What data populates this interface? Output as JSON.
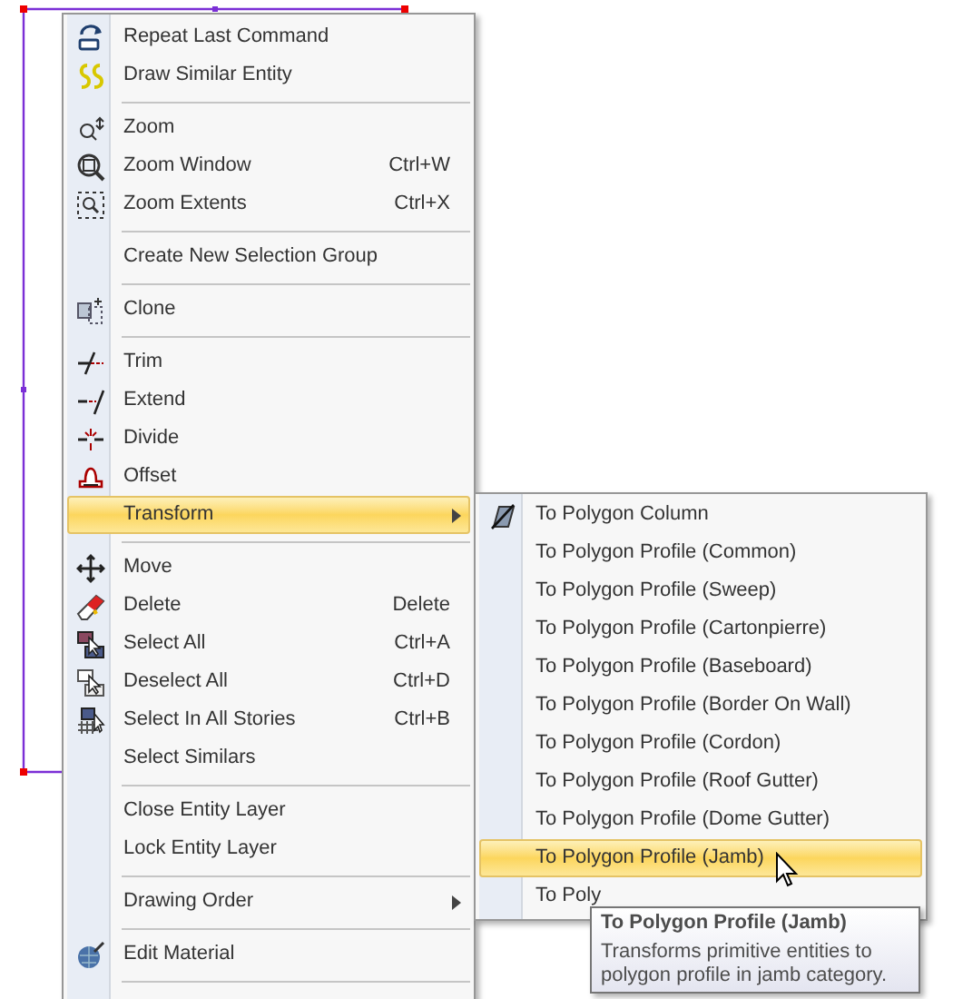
{
  "menu": {
    "items": [
      {
        "kind": "item",
        "label": "Repeat Last Command",
        "selected": false
      },
      {
        "kind": "item",
        "label": "Draw Similar Entity",
        "selected": false
      },
      {
        "kind": "separator"
      },
      {
        "kind": "item",
        "label": "Zoom",
        "selected": false
      },
      {
        "kind": "item",
        "label": "Zoom Window",
        "shortcut": "Ctrl+W",
        "selected": false
      },
      {
        "kind": "item",
        "label": "Zoom Extents",
        "shortcut": "Ctrl+X",
        "selected": false
      },
      {
        "kind": "separator"
      },
      {
        "kind": "item",
        "label": "Create New Selection Group",
        "selected": false
      },
      {
        "kind": "separator"
      },
      {
        "kind": "item",
        "label": "Clone",
        "selected": false
      },
      {
        "kind": "separator"
      },
      {
        "kind": "item",
        "label": "Trim",
        "selected": false
      },
      {
        "kind": "item",
        "label": "Extend",
        "selected": false
      },
      {
        "kind": "item",
        "label": "Divide",
        "selected": false
      },
      {
        "kind": "item",
        "label": "Offset",
        "selected": false
      },
      {
        "kind": "submenu",
        "label": "Transform",
        "selected": true
      },
      {
        "kind": "separator"
      },
      {
        "kind": "item",
        "label": "Move",
        "selected": false
      },
      {
        "kind": "item",
        "label": "Delete",
        "shortcut": "Delete",
        "selected": false
      },
      {
        "kind": "item",
        "label": "Select All",
        "shortcut": "Ctrl+A",
        "selected": false
      },
      {
        "kind": "item",
        "label": "Deselect All",
        "shortcut": "Ctrl+D",
        "selected": false
      },
      {
        "kind": "item",
        "label": "Select In All Stories",
        "shortcut": "Ctrl+B",
        "selected": false
      },
      {
        "kind": "item",
        "label": "Select Similars",
        "selected": false
      },
      {
        "kind": "separator"
      },
      {
        "kind": "item",
        "label": "Close Entity Layer",
        "selected": false
      },
      {
        "kind": "item",
        "label": "Lock Entity Layer",
        "selected": false
      },
      {
        "kind": "separator"
      },
      {
        "kind": "submenu",
        "label": "Drawing Order",
        "selected": false
      },
      {
        "kind": "separator"
      },
      {
        "kind": "item",
        "label": "Edit Material",
        "selected": false
      },
      {
        "kind": "separator"
      }
    ]
  },
  "submenu": {
    "items": [
      {
        "label": "To Polygon Column",
        "selected": false
      },
      {
        "label": "To Polygon Profile (Common)",
        "selected": false
      },
      {
        "label": "To Polygon Profile (Sweep)",
        "selected": false
      },
      {
        "label": "To Polygon Profile (Cartonpierre)",
        "selected": false
      },
      {
        "label": "To Polygon Profile (Baseboard)",
        "selected": false
      },
      {
        "label": "To Polygon Profile (Border On Wall)",
        "selected": false
      },
      {
        "label": "To Polygon Profile (Cordon)",
        "selected": false
      },
      {
        "label": "To Polygon Profile (Roof Gutter)",
        "selected": false
      },
      {
        "label": "To Polygon Profile (Dome Gutter)",
        "selected": false
      },
      {
        "label": "To Polygon Profile (Jamb)",
        "selected": true
      },
      {
        "label": "To Poly",
        "selected": false
      }
    ]
  },
  "tooltip": {
    "title": "To Polygon Profile (Jamb)",
    "text": "Transforms primitive entities to polygon profile in jamb category."
  }
}
